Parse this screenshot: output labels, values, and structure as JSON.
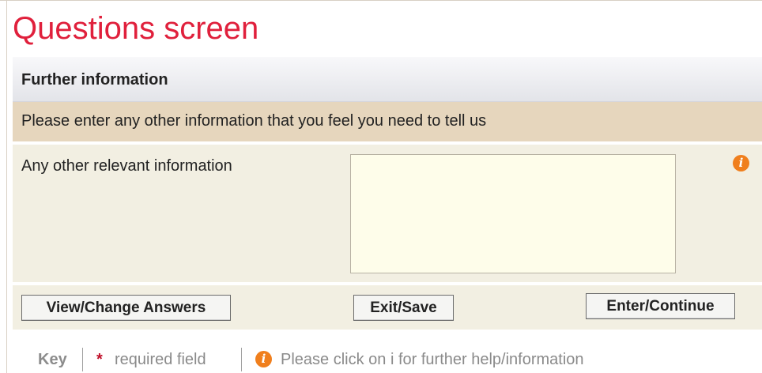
{
  "page": {
    "title": "Questions screen"
  },
  "section": {
    "header": "Further information",
    "instruction": "Please enter any other information that you feel you need to tell us"
  },
  "question": {
    "label": "Any other relevant information",
    "value": "",
    "info_icon": "info-icon"
  },
  "buttons": {
    "view_change": "View/Change Answers",
    "exit_save": "Exit/Save",
    "enter_continue": "Enter/Continue"
  },
  "key": {
    "label": "Key",
    "required_symbol": "*",
    "required_text": "required field",
    "info_symbol": "i",
    "help_text": "Please click on i for further help/information"
  },
  "colors": {
    "title": "#e0203c",
    "instruction_bg": "#e6d6bd",
    "row_bg": "#f2efe2",
    "textarea_bg": "#fefdea",
    "info_icon": "#f07f1d",
    "required_star": "#c0102a"
  }
}
